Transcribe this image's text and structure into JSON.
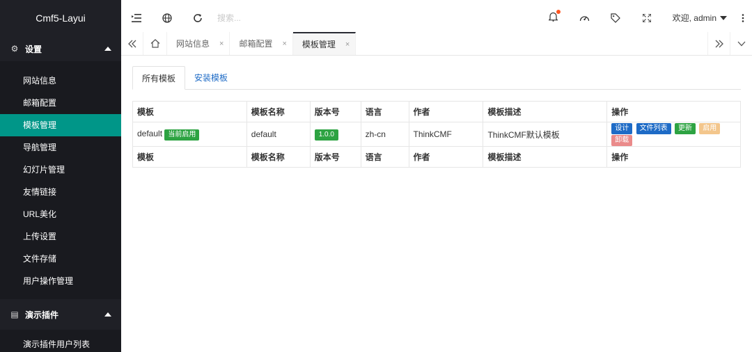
{
  "app": {
    "brand": "Cmf5-Layui"
  },
  "sidebar": {
    "groups": [
      {
        "label": "设置",
        "icon": "gear-icon",
        "items": [
          "网站信息",
          "邮箱配置",
          "模板管理",
          "导航管理",
          "幻灯片管理",
          "友情链接",
          "URL美化",
          "上传设置",
          "文件存储",
          "用户操作管理"
        ],
        "active_item": "模板管理"
      },
      {
        "label": "演示插件",
        "icon": "book-icon",
        "items": [
          "演示插件用户列表"
        ]
      }
    ]
  },
  "header": {
    "search_placeholder": "搜索...",
    "user_label": "欢迎, admin",
    "icons": [
      "menu-fold-icon",
      "globe-icon",
      "refresh-icon",
      "bell-icon",
      "dashboard-icon",
      "tag-icon",
      "fullscreen-icon",
      "more-icon"
    ]
  },
  "tabs": {
    "items": [
      {
        "label": "网站信息",
        "active": false
      },
      {
        "label": "邮箱配置",
        "active": false
      },
      {
        "label": "模板管理",
        "active": true
      }
    ],
    "close_glyph": "×"
  },
  "content": {
    "tabs": [
      {
        "label": "所有模板",
        "active": true
      },
      {
        "label": "安装模板",
        "active": false
      }
    ],
    "table": {
      "headers": [
        "模板",
        "模板名称",
        "版本号",
        "语言",
        "作者",
        "模板描述",
        "操作"
      ],
      "rows": [
        {
          "template": "default",
          "status_badge": "当前启用",
          "name": "default",
          "version": "1.0.0",
          "lang": "zh-cn",
          "author": "ThinkCMF",
          "description": "ThinkCMF默认模板",
          "actions": [
            "设计",
            "文件列表",
            "更新",
            "启用",
            "卸载"
          ]
        }
      ],
      "footer": [
        "模板",
        "模板名称",
        "版本号",
        "语言",
        "作者",
        "模板描述",
        "操作"
      ]
    }
  },
  "colors": {
    "sidebar_bg": "#24262d",
    "active_item": "#009688",
    "link_blue": "#1e6bc6",
    "badge_green": "#2da342",
    "badge_orange": "#f3c68c",
    "badge_pink": "#ea8a8a",
    "notify_dot": "#ff5722"
  }
}
